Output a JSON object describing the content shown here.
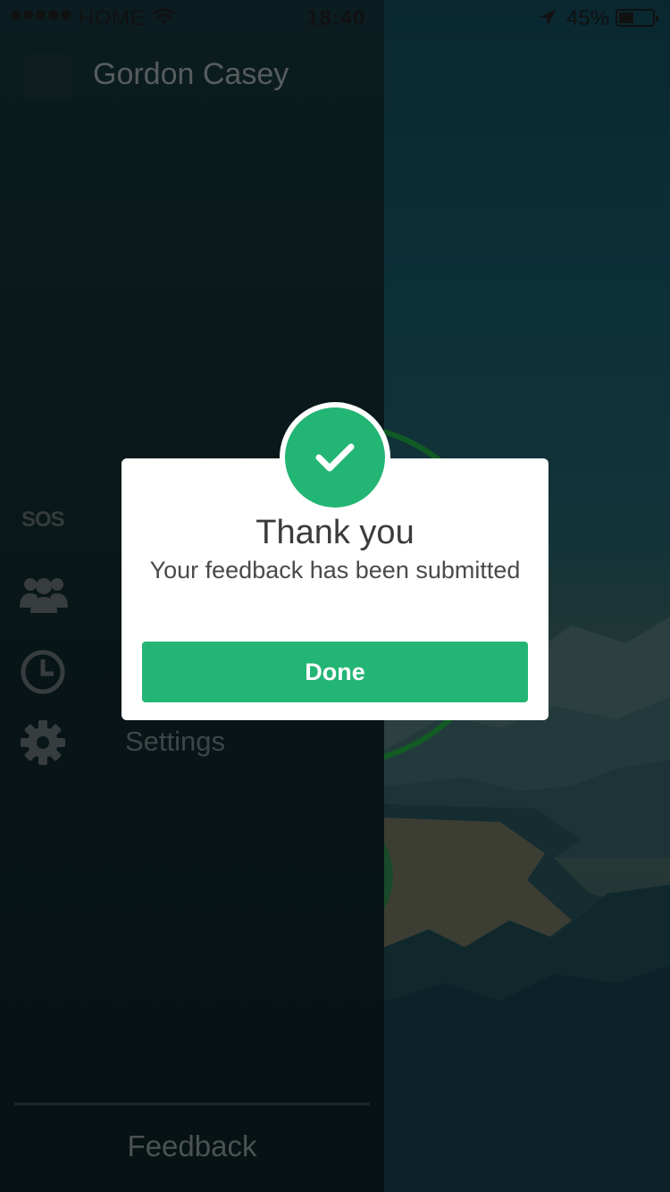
{
  "status_bar": {
    "carrier": "HOME",
    "time": "18:40",
    "battery_percent": "45%",
    "battery_level": 0.45,
    "signal_dots": 5,
    "icons": [
      "wifi-icon",
      "location-arrow-icon",
      "battery-icon"
    ]
  },
  "menu": {
    "user_name": "Gordon Casey",
    "sos_label": "SOS",
    "items": [
      {
        "icon": "group-icon",
        "label": ""
      },
      {
        "icon": "clock-icon",
        "label": ""
      },
      {
        "icon": "gear-icon",
        "label": "Settings"
      }
    ],
    "footer_label": "Feedback"
  },
  "dialog": {
    "icon": "check-icon",
    "title": "Thank you",
    "message": "Your feedback has been submitted",
    "button_label": "Done"
  },
  "colors": {
    "accent": "#23b574",
    "dialog_background": "#ffffff",
    "menu_background": "#0e2427"
  }
}
